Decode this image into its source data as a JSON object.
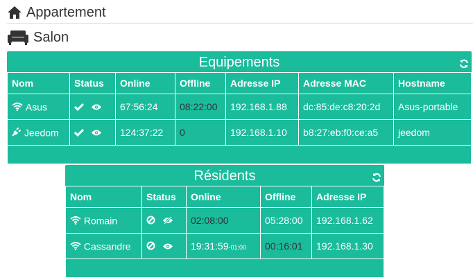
{
  "breadcrumb": {
    "level1": {
      "label": "Appartement",
      "icon": "home-icon"
    },
    "level2": {
      "label": "Salon",
      "icon": "sofa-icon"
    }
  },
  "equipements": {
    "title": "Equipements",
    "headers": [
      "Nom",
      "Status",
      "Online",
      "Offline",
      "Adresse IP",
      "Adresse MAC",
      "Hostname"
    ],
    "rows": [
      {
        "name": "Asus",
        "icon": "wifi-icon",
        "online": "67:56:24",
        "offline": "08:22:00",
        "ip": "192.168.1.88",
        "mac": "dc:85:de:c8:20:2d",
        "hostname": "Asus-portable"
      },
      {
        "name": "Jeedom",
        "icon": "plug-icon",
        "online": "124:37:22",
        "offline": "0",
        "ip": "192.168.1.10",
        "mac": "b8:27:eb:f0:ce:a5",
        "hostname": "jeedom"
      }
    ]
  },
  "residents": {
    "title": "Résidents",
    "headers": [
      "Nom",
      "Status",
      "Online",
      "Offline",
      "Adresse IP"
    ],
    "rows": [
      {
        "name": "Romain",
        "icon": "wifi-icon",
        "online": "02:08:00",
        "offline": "05:28:00",
        "ip": "192.168.1.62"
      },
      {
        "name": "Cassandre",
        "icon": "wifi-icon",
        "online": "19:31:59",
        "online_tz": "-01:00",
        "offline": "00:16:01",
        "ip": "192.168.1.30"
      }
    ]
  },
  "colors": {
    "accent": "#1abc9c",
    "dim_text": "#333333"
  }
}
